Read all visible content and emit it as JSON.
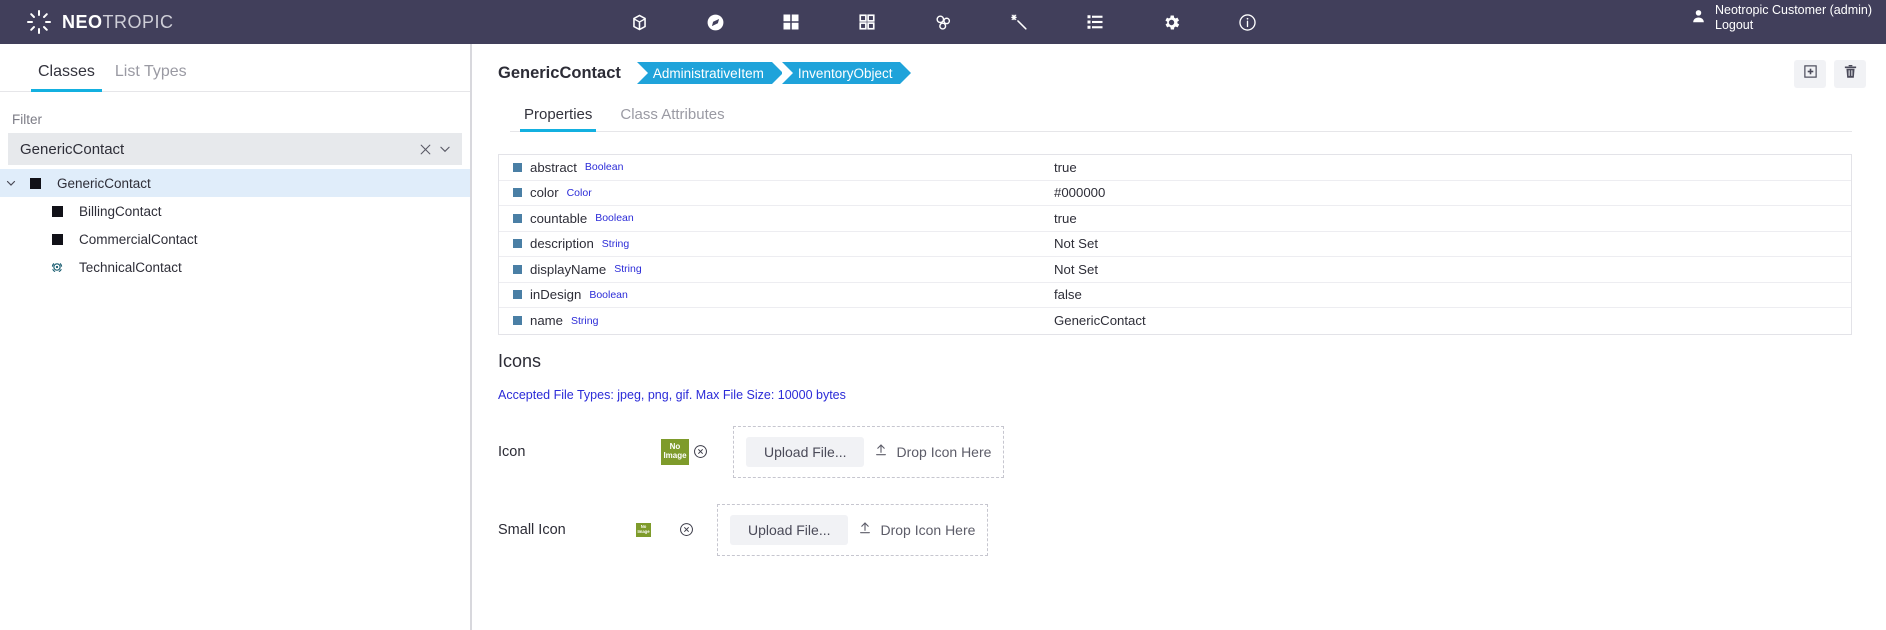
{
  "header": {
    "brand_bold": "NEO",
    "brand_light": "TROPIC",
    "brand_icon": "sunburst-spinner-icon",
    "nav_icons": [
      {
        "name": "cube-icon",
        "glyph": "cube"
      },
      {
        "name": "compass-icon",
        "glyph": "compass"
      },
      {
        "name": "grid-filled-icon",
        "glyph": "grid-filled"
      },
      {
        "name": "grid-outline-icon",
        "glyph": "grid-outline"
      },
      {
        "name": "molecule-icon",
        "glyph": "molecule"
      },
      {
        "name": "magic-wand-icon",
        "glyph": "wand"
      },
      {
        "name": "list-table-icon",
        "glyph": "list"
      },
      {
        "name": "gear-icon",
        "glyph": "gear"
      },
      {
        "name": "info-icon",
        "glyph": "info"
      }
    ],
    "user_name": "Neotropic Customer (admin)",
    "logout_label": "Logout",
    "bg_color": "#413F5B"
  },
  "sidebar": {
    "tabs": [
      {
        "label": "Classes",
        "active": true
      },
      {
        "label": "List Types",
        "active": false
      }
    ],
    "filter_label": "Filter",
    "filter_value": "GenericContact",
    "filter_clear_icon": "close-icon",
    "filter_dropdown_icon": "chevron-down-icon",
    "tree": [
      {
        "label": "GenericContact",
        "level": 0,
        "selected": true,
        "expanded": true,
        "icon": "black-square-icon"
      },
      {
        "label": "BillingContact",
        "level": 1,
        "selected": false,
        "icon": "black-square-icon"
      },
      {
        "label": "CommercialContact",
        "level": 1,
        "selected": false,
        "icon": "black-square-icon"
      },
      {
        "label": "TechnicalContact",
        "level": 1,
        "selected": false,
        "icon": "headset-node-icon"
      }
    ],
    "selected_bg": "#E0EDFA",
    "accent": "#13B0E0"
  },
  "main": {
    "breadcrumb_title": "GenericContact",
    "breadcrumb_pills": [
      "AdministrativeItem",
      "InventoryObject"
    ],
    "pill_color": "#1FA3DA",
    "actions": [
      {
        "name": "add-button",
        "icon": "add-square-icon"
      },
      {
        "name": "delete-button",
        "icon": "trash-icon"
      }
    ],
    "tabs": [
      {
        "label": "Properties",
        "active": true
      },
      {
        "label": "Class Attributes",
        "active": false
      }
    ],
    "properties": [
      {
        "name": "abstract",
        "type": "Boolean",
        "value": "true"
      },
      {
        "name": "color",
        "type": "Color",
        "value": "#000000"
      },
      {
        "name": "countable",
        "type": "Boolean",
        "value": "true"
      },
      {
        "name": "description",
        "type": "String",
        "value": "Not Set"
      },
      {
        "name": "displayName",
        "type": "String",
        "value": "Not Set"
      },
      {
        "name": "inDesign",
        "type": "Boolean",
        "value": "false"
      },
      {
        "name": "name",
        "type": "String",
        "value": "GenericContact"
      }
    ],
    "bullet_color": "#4A7FA5",
    "type_color": "#2b2bd8",
    "icons_heading": "Icons",
    "accepted_text": "Accepted File Types: jpeg, png, gif. Max File Size: 10000 bytes",
    "uploaders": [
      {
        "label": "Icon",
        "thumb_text": "No Image",
        "thumb_color": "#7E9B2B",
        "clear_icon": "clear-circle-icon",
        "upload_label": "Upload File...",
        "drop_label": "Drop Icon Here",
        "drop_icon": "upload-arrow-icon"
      },
      {
        "label": "Small Icon",
        "thumb_text": "No Image",
        "thumb_color": "#7E9B2B",
        "clear_icon": "clear-circle-icon",
        "upload_label": "Upload File...",
        "drop_label": "Drop Icon Here",
        "drop_icon": "upload-arrow-icon"
      }
    ]
  }
}
